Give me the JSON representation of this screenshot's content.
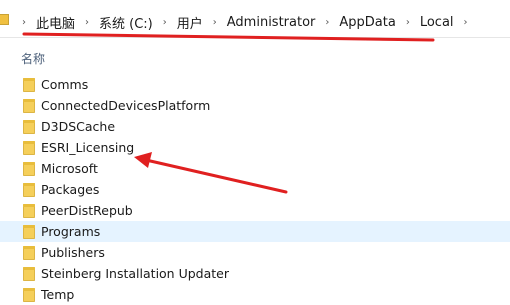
{
  "breadcrumb": {
    "items": [
      "此电脑",
      "系统 (C:)",
      "用户",
      "Administrator",
      "AppData",
      "Local"
    ],
    "separator": "›"
  },
  "list": {
    "column_header": "名称",
    "items": [
      {
        "label": "Comms"
      },
      {
        "label": "ConnectedDevicesPlatform"
      },
      {
        "label": "D3DSCache"
      },
      {
        "label": "ESRI_Licensing"
      },
      {
        "label": "Microsoft"
      },
      {
        "label": "Packages"
      },
      {
        "label": "PeerDistRepub"
      },
      {
        "label": "Programs",
        "selected": true
      },
      {
        "label": "Publishers"
      },
      {
        "label": "Steinberg Installation Updater"
      },
      {
        "label": "Temp"
      }
    ]
  },
  "annotations": {
    "color": "#e02020"
  }
}
